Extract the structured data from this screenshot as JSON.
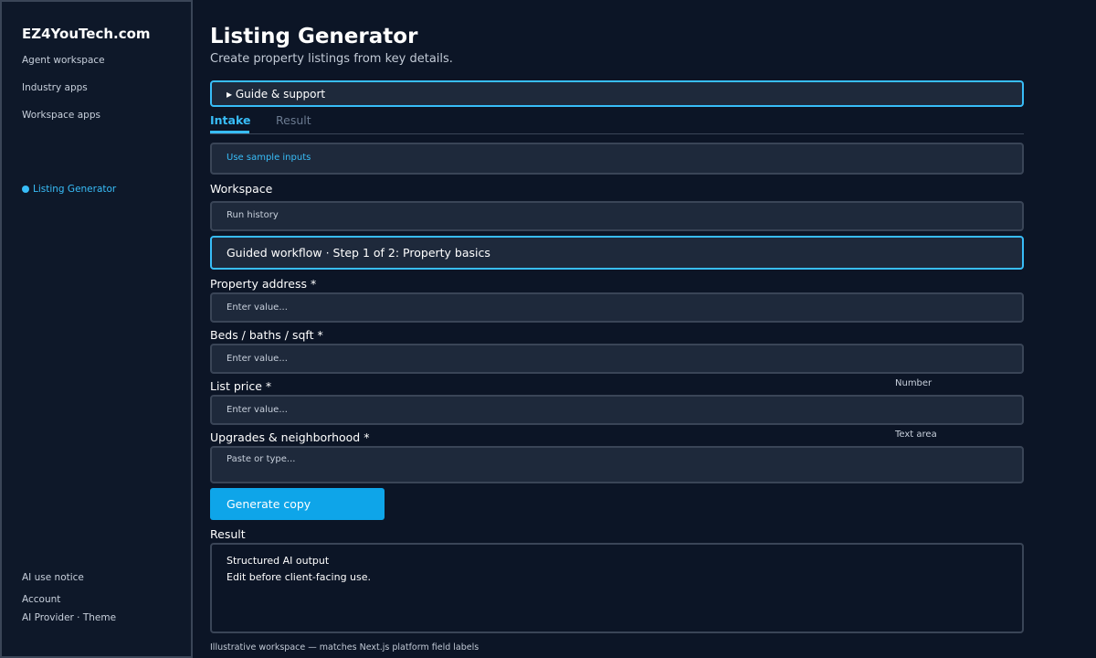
{
  "sidebar": {
    "brand": "EZ4YouTech.com",
    "links": [
      "Agent workspace",
      "Industry apps",
      "Workspace apps"
    ],
    "active": "Listing Generator",
    "bottom": [
      "AI use notice",
      "Account",
      "AI Provider · Theme"
    ]
  },
  "header": {
    "title": "Listing Generator",
    "subtitle": "Create property listings from key details."
  },
  "guide": "▸ Guide & support",
  "tabs": [
    "Intake",
    "Result"
  ],
  "sample_button": "Use sample inputs",
  "workspace_label": "Workspace",
  "run_history": "Run history",
  "wizard": "Guided workflow · Step 1 of 2: Property basics",
  "fields": [
    {
      "label": "Property address *",
      "hint": "",
      "placeholder": "Enter value..."
    },
    {
      "label": "Beds / baths / sqft *",
      "hint": "",
      "placeholder": "Enter value..."
    },
    {
      "label": "List price *",
      "hint": "Number",
      "placeholder": "Enter value..."
    },
    {
      "label": "Upgrades & neighborhood *",
      "hint": "Text area",
      "placeholder": "Paste or type..."
    }
  ],
  "generate_button": "Generate copy",
  "result": {
    "label": "Result",
    "line1": "Structured AI output",
    "line2": "Edit before client-facing use."
  },
  "footer": "Illustrative workspace — matches Next.js platform field labels",
  "colors": {
    "accent": "#38bdf8",
    "button": "#0ea5e9",
    "panel": "#1e293b",
    "background": "#0c1526"
  }
}
